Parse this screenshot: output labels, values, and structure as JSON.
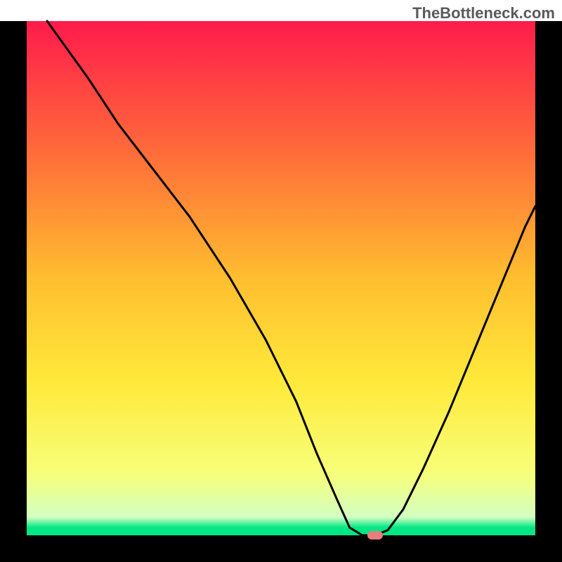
{
  "watermark": "TheBottleneck.com",
  "chart_data": {
    "type": "line",
    "title": "",
    "xlabel": "",
    "ylabel": "",
    "xlim": [
      0,
      100
    ],
    "ylim": [
      0,
      100
    ],
    "background_gradient": {
      "stops": [
        {
          "offset": 0.0,
          "color": "#ff1b4b"
        },
        {
          "offset": 0.25,
          "color": "#ff6a3a"
        },
        {
          "offset": 0.5,
          "color": "#ffbe2f"
        },
        {
          "offset": 0.7,
          "color": "#ffe93a"
        },
        {
          "offset": 0.88,
          "color": "#f7ff7a"
        },
        {
          "offset": 0.965,
          "color": "#d2ffc1"
        },
        {
          "offset": 0.985,
          "color": "#00e785"
        },
        {
          "offset": 1.0,
          "color": "#00e785"
        }
      ]
    },
    "series": [
      {
        "name": "bottleneck-curve",
        "color": "#000000",
        "x": [
          4,
          12,
          18,
          25,
          32,
          40,
          47,
          53,
          57,
          61,
          63.5,
          66,
          68.5,
          71,
          74,
          78,
          83,
          88,
          93,
          98,
          100
        ],
        "values": [
          100,
          89,
          80,
          71,
          62,
          50,
          38,
          26,
          16,
          7,
          1.5,
          0,
          0,
          1,
          5,
          13,
          24,
          36,
          48,
          60,
          64
        ]
      }
    ],
    "marker": {
      "x": 68.5,
      "y": 0,
      "color": "#e97d7d",
      "label": "selected-point"
    }
  },
  "frame": {
    "color": "#000000",
    "thickness_ratio": 0.0475
  }
}
